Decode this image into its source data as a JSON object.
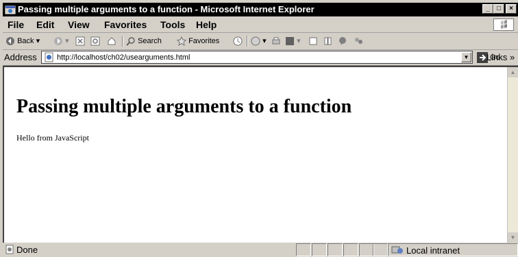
{
  "window": {
    "title": "Passing multiple arguments to a function - Microsoft Internet Explorer",
    "controls": {
      "minimize": "_",
      "maximize": "□",
      "close": "×"
    }
  },
  "menu": {
    "items": [
      {
        "label": "File"
      },
      {
        "label": "Edit"
      },
      {
        "label": "View"
      },
      {
        "label": "Favorites"
      },
      {
        "label": "Tools"
      },
      {
        "label": "Help"
      }
    ]
  },
  "toolbar": {
    "back_label": "Back",
    "search_label": "Search",
    "favorites_label": "Favorites"
  },
  "address": {
    "label": "Address",
    "url": "http://localhost/ch02/usearguments.html",
    "go_label": "Go",
    "links_label": "Links »"
  },
  "page": {
    "heading": "Passing multiple arguments to a function",
    "body_text": "Hello from JavaScript"
  },
  "status": {
    "text": "Done",
    "zone": "Local intranet"
  },
  "colors": {
    "titlebar": "#000000",
    "chrome": "#d4d0c8",
    "content": "#ffffff"
  }
}
